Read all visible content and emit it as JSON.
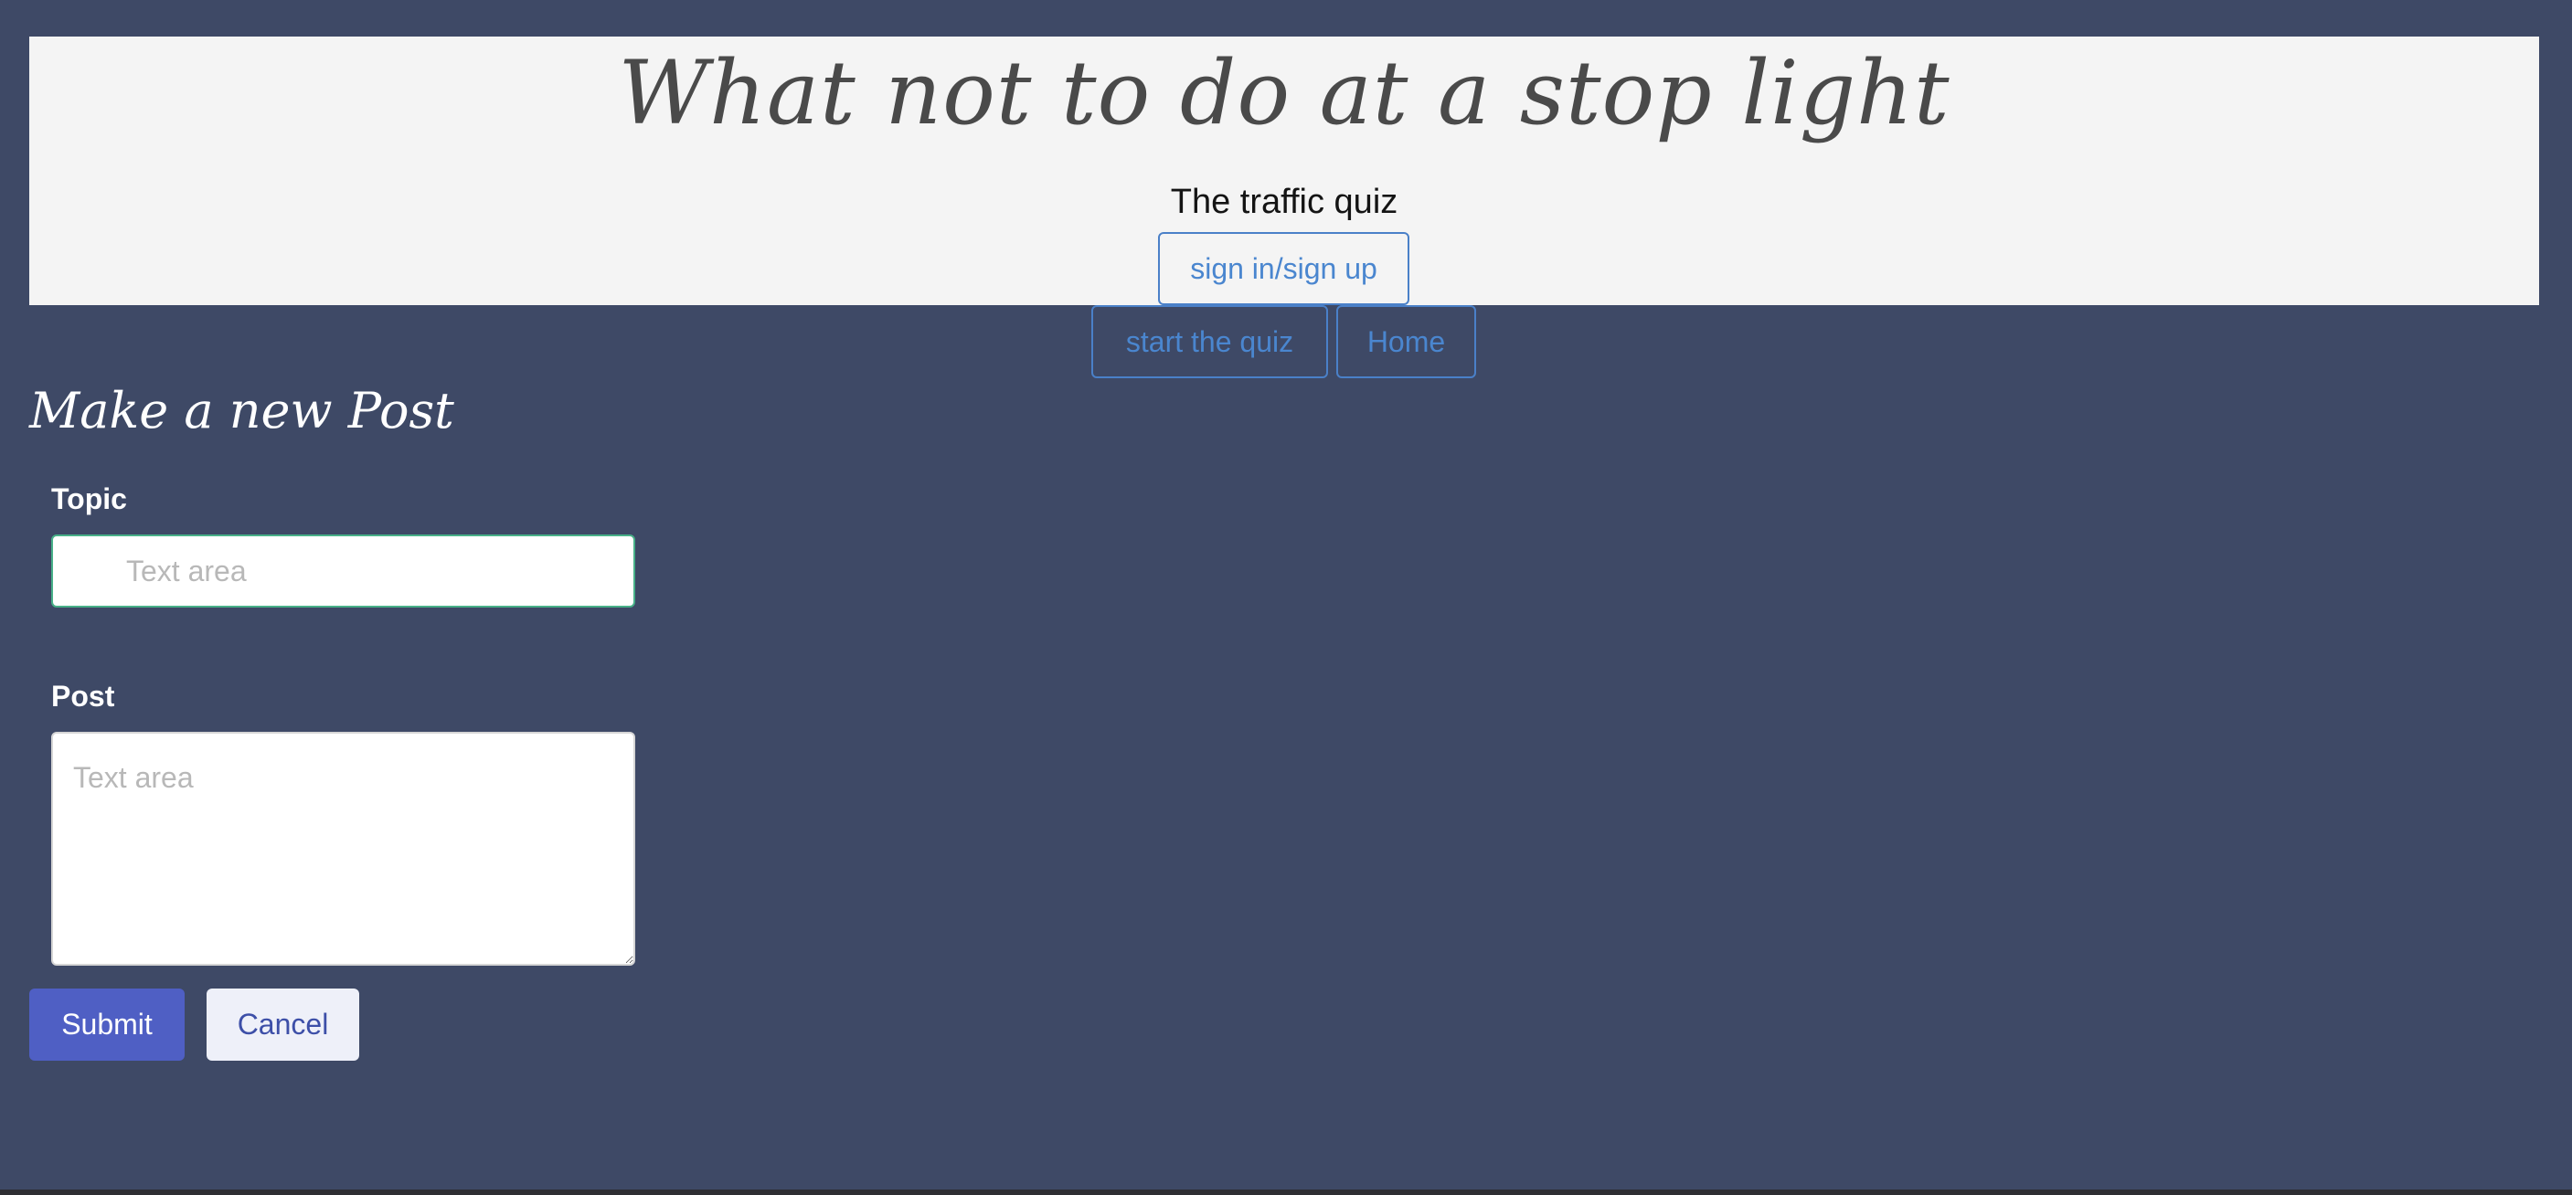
{
  "header": {
    "title": "What not to do at a stop light",
    "subtitle": "The traffic quiz"
  },
  "nav": {
    "sign_in_label": "sign in/sign up",
    "start_quiz_label": "start the quiz",
    "home_label": "Home"
  },
  "form": {
    "title": "Make a new Post",
    "topic_label": "Topic",
    "topic_placeholder": "Text area",
    "topic_value": "",
    "post_label": "Post",
    "post_placeholder": "Text area",
    "post_value": "",
    "submit_label": "Submit",
    "cancel_label": "Cancel"
  },
  "colors": {
    "page_background": "#3e4966",
    "header_background": "#f4f4f4",
    "nav_button_accent": "#4a86cf",
    "submit_background": "#4f5fc4",
    "cancel_background": "#eef0f9",
    "topic_focus_border": "#48b088"
  }
}
